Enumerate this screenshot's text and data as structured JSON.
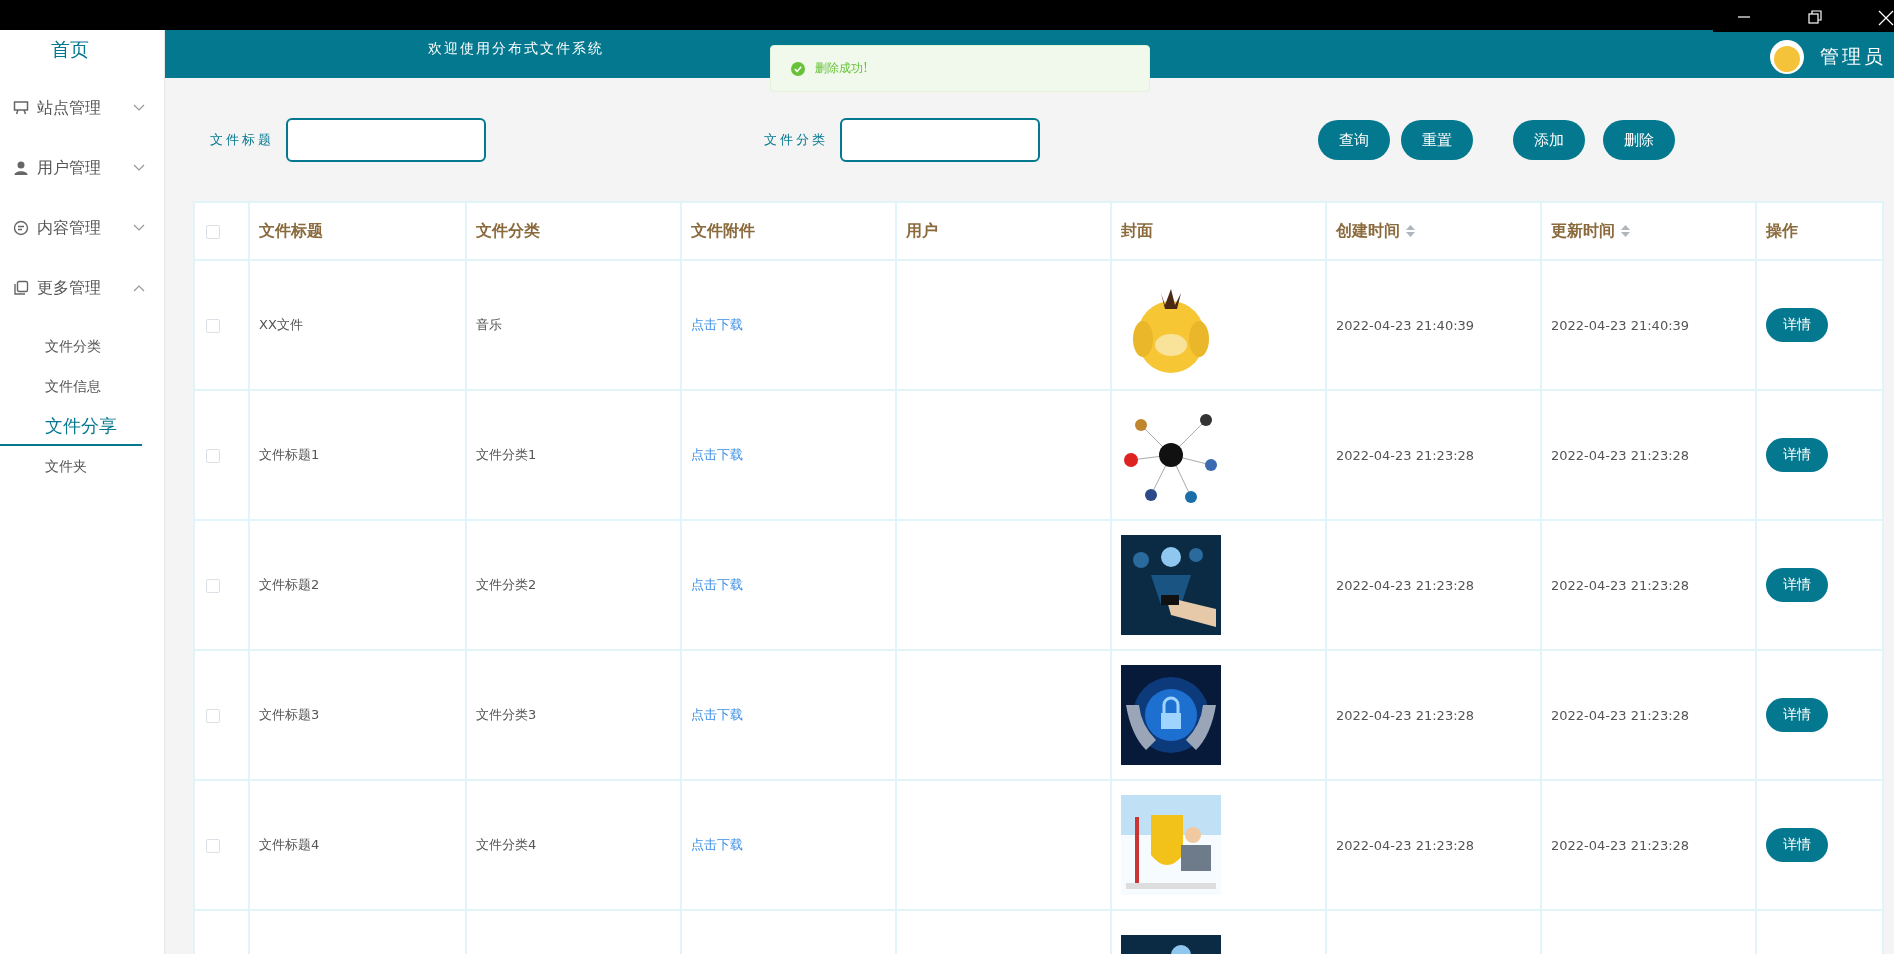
{
  "sidebar": {
    "home": "首页",
    "menus": [
      {
        "label": "站点管理",
        "expanded": false
      },
      {
        "label": "用户管理",
        "expanded": false
      },
      {
        "label": "内容管理",
        "expanded": false
      },
      {
        "label": "更多管理",
        "expanded": true,
        "children": [
          {
            "label": "文件分类",
            "selected": false
          },
          {
            "label": "文件信息",
            "selected": false
          },
          {
            "label": "文件分享",
            "selected": true
          },
          {
            "label": "文件夹",
            "selected": false
          }
        ]
      }
    ]
  },
  "header": {
    "title": "欢迎使用分布式文件系统",
    "user": "管理员"
  },
  "toast": {
    "message": "删除成功!"
  },
  "search": {
    "fields": [
      {
        "label": "文件标题"
      },
      {
        "label": "文件分类"
      }
    ],
    "button_groups": [
      [
        "查询",
        "重置"
      ],
      [
        "添加",
        "删除"
      ]
    ]
  },
  "table": {
    "columns": [
      {
        "kind": "checkbox",
        "checked": false
      },
      {
        "kind": "text",
        "label": "文件标题"
      },
      {
        "kind": "text",
        "label": "文件分类"
      },
      {
        "kind": "text",
        "label": "文件附件"
      },
      {
        "kind": "text",
        "label": "用户"
      },
      {
        "kind": "text",
        "label": "封面"
      },
      {
        "kind": "text",
        "label": "创建时间",
        "sortable": true
      },
      {
        "kind": "text",
        "label": "更新时间",
        "sortable": true
      },
      {
        "kind": "text",
        "label": "操作"
      }
    ],
    "rows": [
      {
        "checked": false,
        "title": "XX文件",
        "category": "音乐",
        "attachment": "点击下载",
        "cover": {
          "kind": "picture"
        },
        "created": "2022-04-23 21:40:39",
        "updated": "2022-04-23 21:40:39",
        "action": "详情"
      },
      {
        "checked": false,
        "title": "文件标题1",
        "category": "文件分类1",
        "attachment": "点击下载",
        "cover": {
          "kind": "picture"
        },
        "created": "2022-04-23 21:23:28",
        "updated": "2022-04-23 21:23:28",
        "action": "详情"
      },
      {
        "checked": false,
        "title": "文件标题2",
        "category": "文件分类2",
        "attachment": "点击下载",
        "cover": {
          "kind": "picture"
        },
        "created": "2022-04-23 21:23:28",
        "updated": "2022-04-23 21:23:28",
        "action": "详情"
      },
      {
        "checked": false,
        "title": "文件标题3",
        "category": "文件分类3",
        "attachment": "点击下载",
        "cover": {
          "kind": "picture"
        },
        "created": "2022-04-23 21:23:28",
        "updated": "2022-04-23 21:23:28",
        "action": "详情"
      },
      {
        "checked": false,
        "title": "文件标题4",
        "category": "文件分类4",
        "attachment": "点击下载",
        "cover": {
          "kind": "picture"
        },
        "created": "2022-04-23 21:23:28",
        "updated": "2022-04-23 21:23:28",
        "action": "详情"
      },
      {
        "cover": {
          "kind": "picture"
        }
      }
    ]
  }
}
